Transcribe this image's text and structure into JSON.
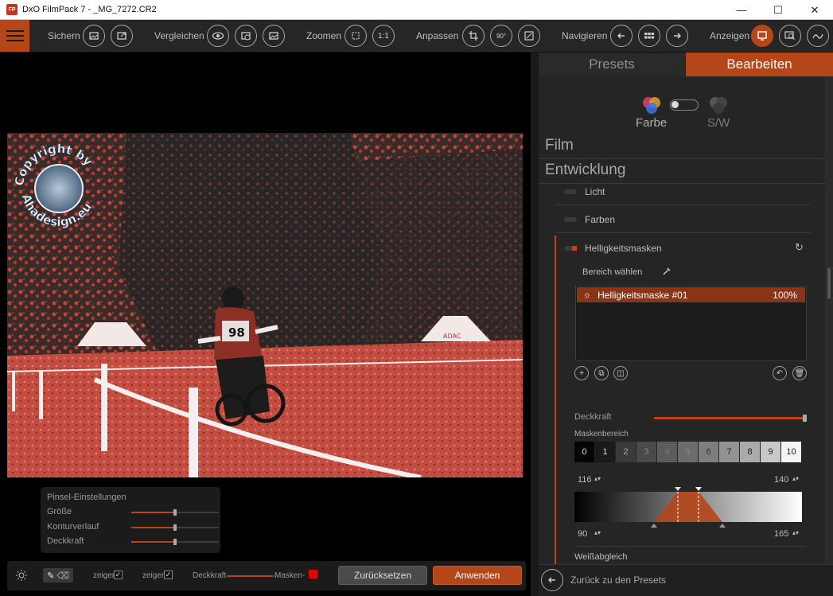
{
  "window": {
    "title": "DxO FilmPack 7 - _MG_7272.CR2",
    "app_icon_text": "FP",
    "minimize": "—",
    "maximize": "☐",
    "close": "✕"
  },
  "toolbar": {
    "save_label": "Sichern",
    "compare_label": "Vergleichen",
    "zoom_label": "Zoomen",
    "zoom_1to1": "1:1",
    "adjust_label": "Anpassen",
    "rotate_label": "90°",
    "navigate_label": "Navigieren",
    "view_label": "Anzeigen"
  },
  "photo": {
    "watermark_top": "Copyright by",
    "watermark_bottom": "Ahadesign.eu",
    "bib_number": "98",
    "tent_label": "ADAC"
  },
  "brush_settings": {
    "title": "Pinsel-Einstellungen",
    "rows": [
      {
        "label": "Größe",
        "value": 0.5
      },
      {
        "label": "Konturverlauf",
        "value": 0.5
      },
      {
        "label": "Deckkraft",
        "value": 0.5
      }
    ]
  },
  "bottom_bar": {
    "show_label_1": "zeigen",
    "show_label_2": "zeigen",
    "opacity_label": "Deckkraft",
    "mask_label": "Masken-",
    "mask_color": "#e00000",
    "reset_button": "Zurücksetzen",
    "apply_button": "Anwenden",
    "check_1": "✓",
    "check_2": "✓"
  },
  "panel": {
    "tab_presets": "Presets",
    "tab_edit": "Bearbeiten",
    "mode_color": "Farbe",
    "mode_bw": "S/W",
    "section_film": "Film",
    "section_development": "Entwicklung",
    "sub_light": "Licht",
    "sub_colors": "Farben",
    "sub_luma_masks": "Helligkeitsmasken",
    "select_area": "Bereich wählen",
    "mask_items": [
      {
        "name": "Helligkeitsmaske #01",
        "opacity": "100%"
      }
    ],
    "opacity_label": "Deckkraft",
    "opacity_value": 1.0,
    "mask_range_label": "Maskenbereich",
    "zones": [
      "0",
      "1",
      "2",
      "3",
      "4",
      "5",
      "6",
      "7",
      "8",
      "9",
      "10"
    ],
    "range_top_left": "116",
    "range_top_right": "140",
    "range_bottom_left": "90",
    "range_bottom_right": "165",
    "white_balance": "Weißabgleich",
    "back_to_presets": "Zurück zu den Presets"
  },
  "colors": {
    "accent": "#b4461a",
    "mask_red": "#d43a1a"
  }
}
